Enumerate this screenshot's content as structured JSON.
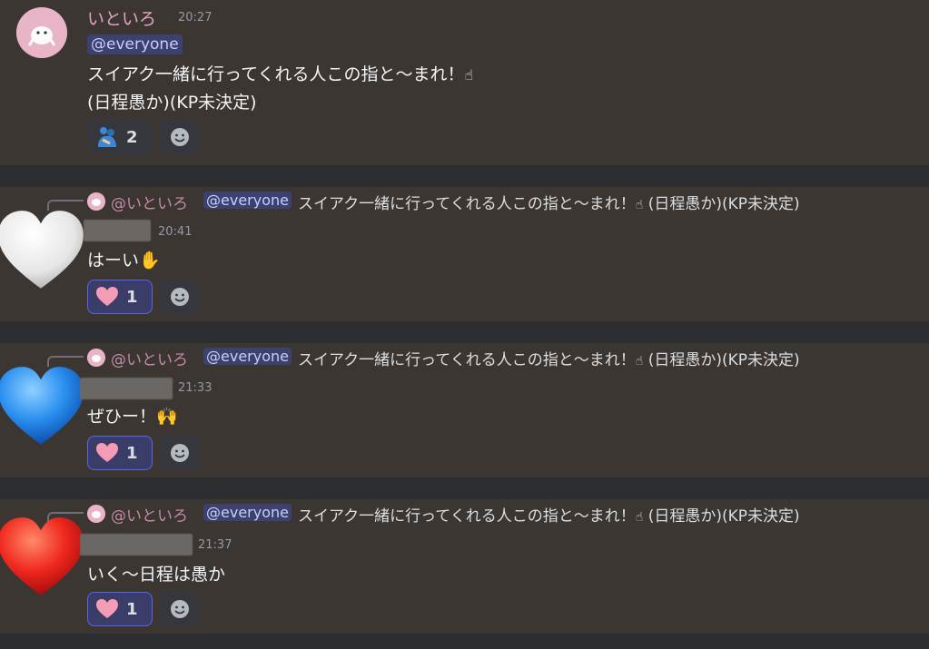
{
  "colors": {
    "bg": "#2b2d31",
    "message_bg": "#3b3631",
    "mention_bg": "#3c4270",
    "mention_text": "#c9cdfb",
    "username_pink": "#e2a4c6",
    "reaction_active_border": "#5865f2"
  },
  "main_message": {
    "username": "いといろ",
    "time": "20:27",
    "mention": "@everyone",
    "line1": "スイアク一緒に行ってくれる人この指と～まれ！",
    "line2": "(日程愚か)(KP未決定)",
    "reaction_icon": "people-hugging-emoji",
    "reaction_count": "2",
    "add_reaction_icon": "smiley-add-icon"
  },
  "replies": [
    {
      "avatar_icon": "white-heart-emoji",
      "reply_to_name": "@いといろ",
      "reply_mention": "@everyone",
      "reply_text": "スイアク一緒に行ってくれる人この指と～まれ！",
      "reply_suffix": "(日程愚か)(KP未決定)",
      "time": "20:41",
      "text": "はーい",
      "text_emoji": "raised-hand-emoji",
      "reaction_icon": "pink-heart-emoji",
      "reaction_count": "1"
    },
    {
      "avatar_icon": "blue-heart-emoji",
      "reply_to_name": "@いといろ",
      "reply_mention": "@everyone",
      "reply_text": "スイアク一緒に行ってくれる人この指と～まれ！",
      "reply_suffix": "(日程愚か)(KP未決定)",
      "time": "21:33",
      "text": "ぜひー！",
      "text_emoji": "raising-hands-emoji",
      "reaction_icon": "pink-heart-emoji",
      "reaction_count": "1"
    },
    {
      "avatar_icon": "red-heart-emoji",
      "reply_to_name": "@いといろ",
      "reply_mention": "@everyone",
      "reply_text": "スイアク一緒に行ってくれる人この指と～まれ！",
      "reply_suffix": "(日程愚か)(KP未決定)",
      "time": "21:37",
      "text": "いく～日程は愚か",
      "text_emoji": "",
      "reaction_icon": "pink-heart-emoji",
      "reaction_count": "1"
    }
  ]
}
